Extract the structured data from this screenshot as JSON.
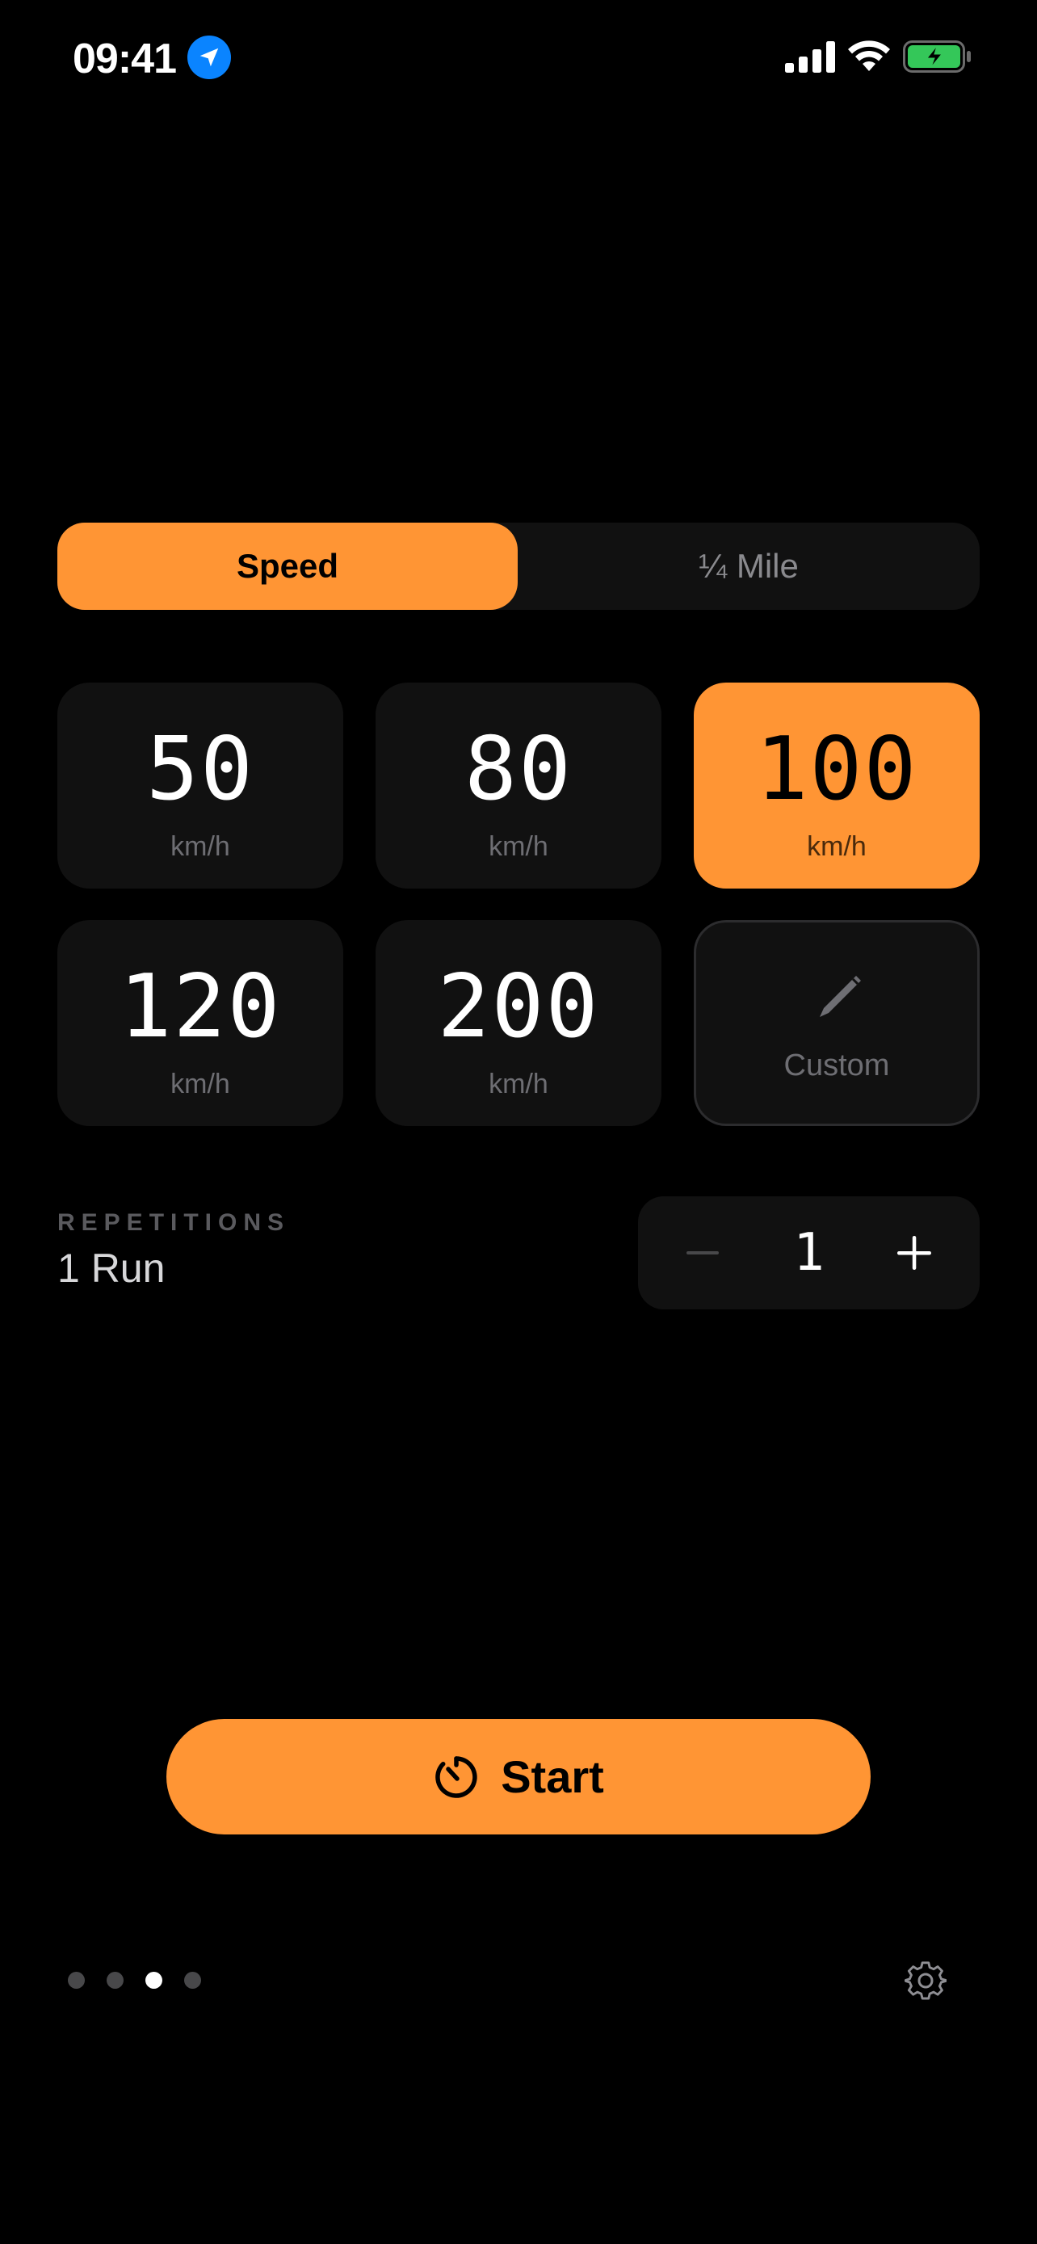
{
  "status_bar": {
    "time": "09:41",
    "location_icon": "location-arrow-icon",
    "signal_icon": "cellular-signal-icon",
    "wifi_icon": "wifi-icon",
    "battery_icon": "battery-charging-icon",
    "battery_color": "#34c759"
  },
  "mode_selector": {
    "options": [
      {
        "label": "Speed",
        "selected": true
      },
      {
        "label": "¼ Mile",
        "selected": false
      }
    ]
  },
  "speed_presets": [
    {
      "value": "50",
      "unit": "km/h",
      "selected": false
    },
    {
      "value": "80",
      "unit": "km/h",
      "selected": false
    },
    {
      "value": "100",
      "unit": "km/h",
      "selected": true
    },
    {
      "value": "120",
      "unit": "km/h",
      "selected": false
    },
    {
      "value": "200",
      "unit": "km/h",
      "selected": false
    }
  ],
  "custom_tile": {
    "label": "Custom",
    "icon": "pencil-icon"
  },
  "repetitions": {
    "label": "REPETITIONS",
    "summary": "1 Run",
    "count": "1",
    "decrement_icon": "minus-icon",
    "increment_icon": "plus-icon"
  },
  "start_button": {
    "label": "Start",
    "icon": "timer-icon"
  },
  "pager": {
    "total_pages": 4,
    "current_page": 3
  },
  "settings": {
    "icon": "gear-icon"
  },
  "colors": {
    "accent": "#ff9534",
    "background": "#000000",
    "surface": "#111111",
    "secondary_text": "#6e6e73"
  }
}
